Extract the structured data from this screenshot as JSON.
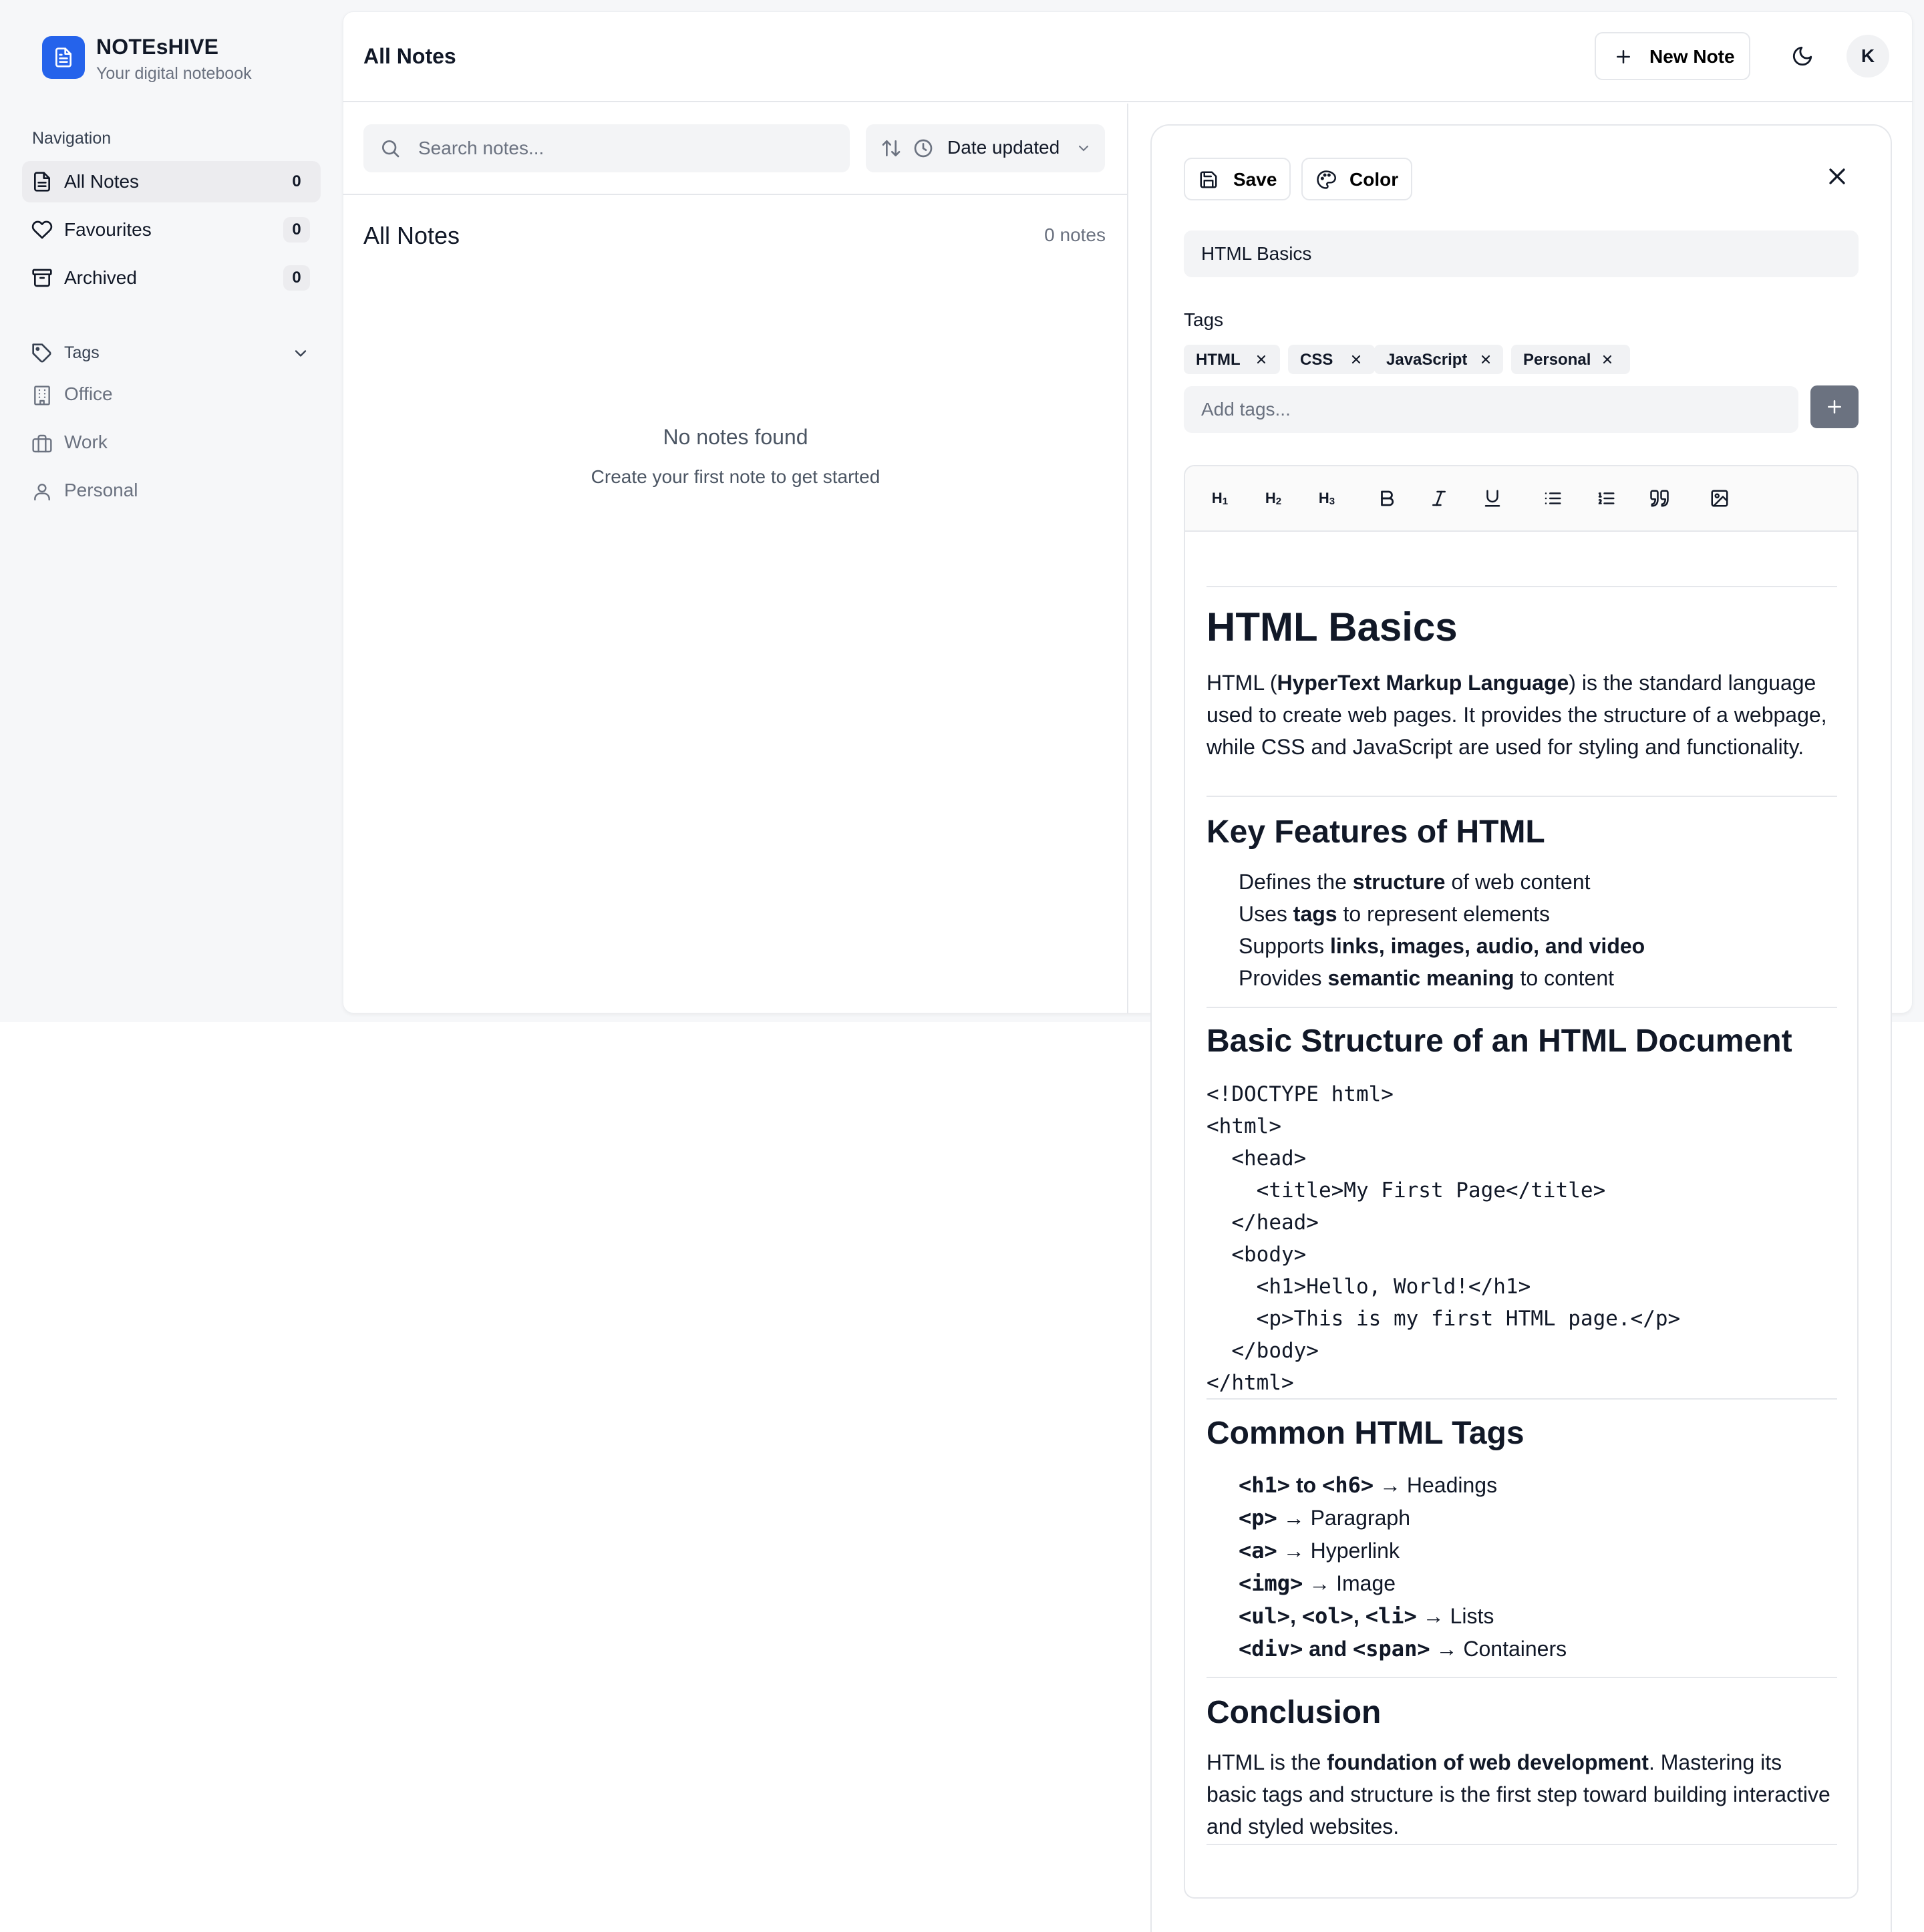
{
  "app": {
    "name": "NOTEsHIVE",
    "tagline": "Your digital notebook"
  },
  "sidebar": {
    "nav_heading": "Navigation",
    "items": [
      {
        "label": "All Notes",
        "count": "0",
        "icon": "file-text-icon",
        "active": true
      },
      {
        "label": "Favourites",
        "count": "0",
        "icon": "heart-icon",
        "active": false
      },
      {
        "label": "Archived",
        "count": "0",
        "icon": "archive-icon",
        "active": false
      }
    ],
    "tags_heading": "Tags",
    "tags": [
      {
        "label": "Office",
        "icon": "building-icon"
      },
      {
        "label": "Work",
        "icon": "briefcase-icon"
      },
      {
        "label": "Personal",
        "icon": "user-icon"
      }
    ]
  },
  "header": {
    "title": "All Notes",
    "new_note_label": "New Note",
    "avatar_initial": "K"
  },
  "list": {
    "search_placeholder": "Search notes...",
    "sort_label": "Date updated",
    "title": "All Notes",
    "count_text": "0 notes",
    "empty_title": "No notes found",
    "empty_sub": "Create your first note to get started"
  },
  "editor": {
    "save_label": "Save",
    "color_label": "Color",
    "title_value": "HTML Basics",
    "tags_label": "Tags",
    "tags": [
      "HTML",
      "CSS",
      "JavaScript",
      "Personal"
    ],
    "add_tags_placeholder": "Add tags...",
    "toolbar": [
      {
        "name": "heading-1-button",
        "label": "H",
        "sub": "1"
      },
      {
        "name": "heading-2-button",
        "label": "H",
        "sub": "2"
      },
      {
        "name": "heading-3-button",
        "label": "H",
        "sub": "3"
      }
    ],
    "doc": {
      "h1": "HTML Basics",
      "intro": {
        "a": "HTML (",
        "b": "HyperText Markup Language",
        "c": ") is the standard language used to create web pages. It provides the structure of a webpage, while CSS and JavaScript are used for styling and functionality."
      },
      "features_heading": "Key Features of HTML",
      "features": [
        {
          "pre": "Defines the ",
          "bold": "structure",
          "post": " of web content"
        },
        {
          "pre": "Uses ",
          "bold": "tags",
          "post": " to represent elements"
        },
        {
          "pre": "Supports ",
          "bold": "links, images, audio, and video",
          "post": ""
        },
        {
          "pre": "Provides ",
          "bold": "semantic meaning",
          "post": " to content"
        }
      ],
      "structure_heading": "Basic Structure of an HTML Document",
      "code": "<!DOCTYPE html>\n<html>\n  <head>\n    <title>My First Page</title>\n  </head>\n  <body>\n    <h1>Hello, World!</h1>\n    <p>This is my first HTML page.</p>\n  </body>\n</html>",
      "tags_heading": "Common HTML Tags",
      "tag_list": [
        {
          "codes": [
            "<h1>",
            " to ",
            "<h6>"
          ],
          "desc": " → Headings"
        },
        {
          "codes": [
            "<p>"
          ],
          "desc": " → Paragraph"
        },
        {
          "codes": [
            "<a>"
          ],
          "desc": " → Hyperlink"
        },
        {
          "codes": [
            "<img>"
          ],
          "desc": " → Image"
        },
        {
          "codes": [
            "<ul>",
            ", ",
            "<ol>",
            ", ",
            "<li>"
          ],
          "desc": " → Lists"
        },
        {
          "codes": [
            "<div>",
            " and ",
            "<span>"
          ],
          "desc": " → Containers"
        }
      ],
      "conclusion_heading": "Conclusion",
      "conclusion": {
        "a": "HTML is the ",
        "b": "foundation of web development",
        "c": ". Mastering its basic tags and structure is the first step toward building interactive and styled websites."
      }
    }
  },
  "colors": {
    "brand": "#2563eb",
    "app_background": "#f6f7f9",
    "border": "#e5e7eb",
    "muted_text": "#6b7280",
    "add_tag_button": "#6b7280"
  }
}
